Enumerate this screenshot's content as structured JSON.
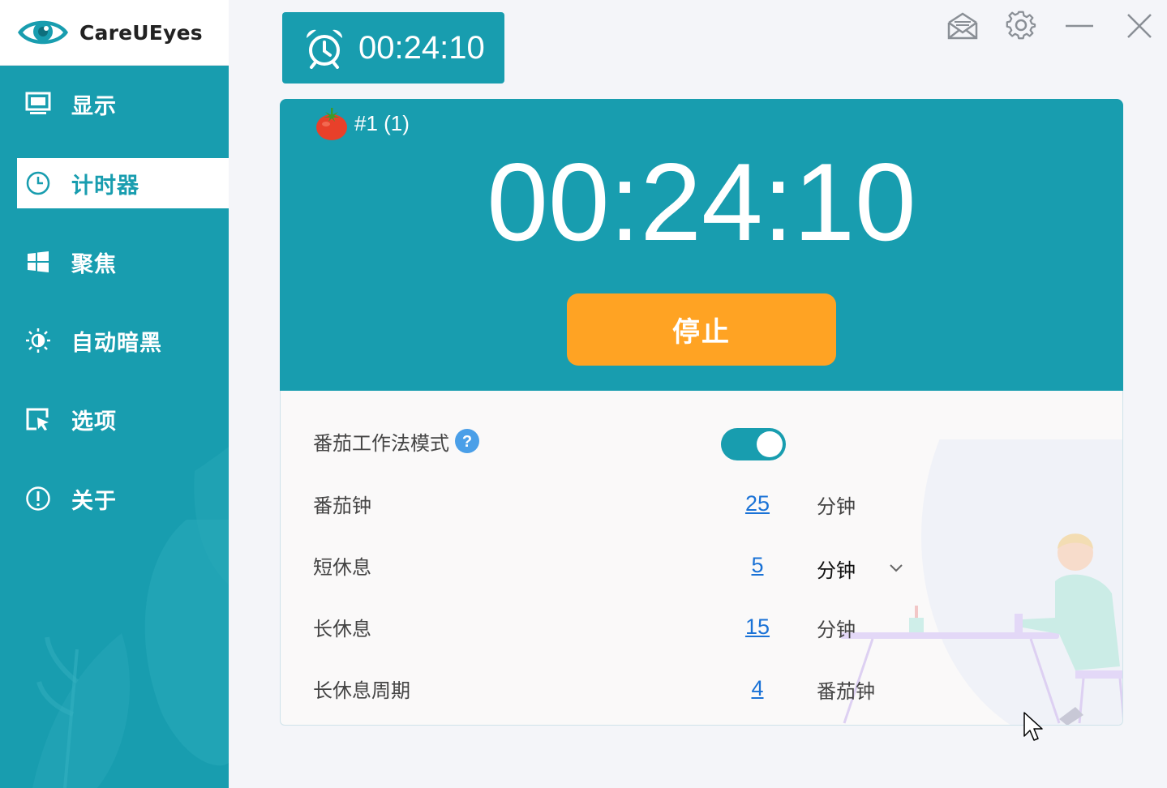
{
  "app": {
    "name": "CareUEyes"
  },
  "sidebar": {
    "items": [
      {
        "label": "显示",
        "icon": "monitor-icon"
      },
      {
        "label": "计时器",
        "icon": "clock-icon",
        "active": true
      },
      {
        "label": "聚焦",
        "icon": "windows-icon"
      },
      {
        "label": "自动暗黑",
        "icon": "auto-dark-icon"
      },
      {
        "label": "选项",
        "icon": "options-icon"
      },
      {
        "label": "关于",
        "icon": "info-icon"
      }
    ]
  },
  "topbar": {
    "timer_tab": {
      "time": "00:24:10",
      "icon": "alarm-clock-icon"
    },
    "controls": [
      "mail-icon",
      "settings-gear-icon",
      "minimize-icon",
      "close-icon"
    ]
  },
  "timer": {
    "round": "#1 (1)",
    "round_icon": "tomato-icon",
    "time": "00:24:10",
    "stop_label": "停止"
  },
  "settings": {
    "pomodoro_mode": {
      "label": "番茄工作法模式",
      "enabled": true,
      "help_icon": "question-icon"
    },
    "pomodoro": {
      "label": "番茄钟",
      "value": "25",
      "unit": "分钟"
    },
    "short_break": {
      "label": "短休息",
      "value": "5",
      "unit": "分钟"
    },
    "long_break": {
      "label": "长休息",
      "value": "15",
      "unit": "分钟"
    },
    "long_break_cycle": {
      "label": "长休息周期",
      "value": "4",
      "unit": "番茄钟"
    }
  },
  "colors": {
    "primary": "#189daf",
    "stop_button": "#ffa323",
    "link": "#1a72d6",
    "background": "#f4f5f9"
  }
}
